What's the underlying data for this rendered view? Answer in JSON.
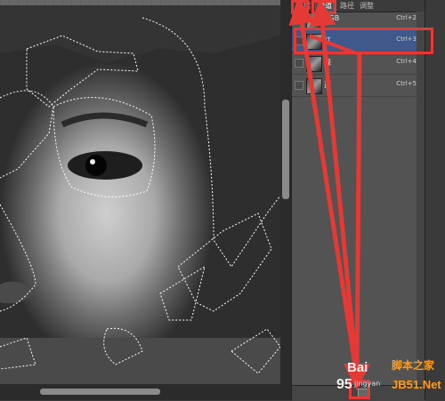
{
  "panel": {
    "tabs": [
      {
        "label": "图层",
        "active": false
      },
      {
        "label": "通道",
        "active": true
      },
      {
        "label": "路径",
        "active": false
      },
      {
        "label": "调整",
        "active": false
      }
    ],
    "channels": [
      {
        "name": "RGB",
        "shortcut": "Ctrl+2",
        "visible": false,
        "selected": false
      },
      {
        "name": "红",
        "shortcut": "Ctrl+3",
        "visible": true,
        "selected": true
      },
      {
        "name": "绿",
        "shortcut": "Ctrl+4",
        "visible": false,
        "selected": false
      },
      {
        "name": "蓝",
        "shortcut": "Ctrl+5",
        "visible": false,
        "selected": false
      }
    ]
  },
  "watermark": {
    "baidu": "Bai",
    "baidu_cn": "脚本之家",
    "jingyan": "jingyan",
    "net": "JB51.Net",
    "prefix": "95"
  },
  "colors": {
    "annotation": "#e53935",
    "selected_row": "#3f5a8a"
  }
}
